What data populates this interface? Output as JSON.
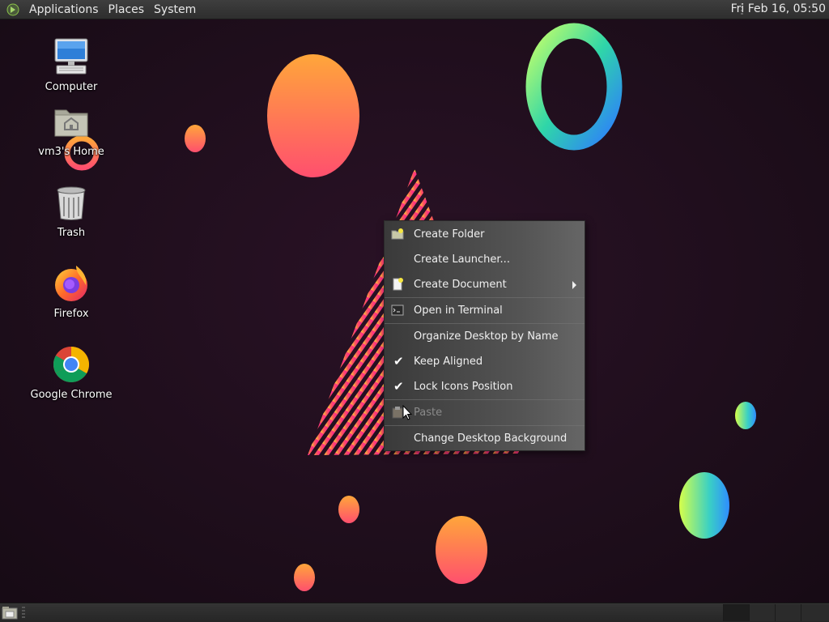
{
  "top_panel": {
    "menus": [
      "Applications",
      "Places",
      "System"
    ],
    "clock": "Fri Feb 16, 05:50"
  },
  "desktop_icons": [
    {
      "label": "Computer",
      "icon": "computer-icon"
    },
    {
      "label": "vm3's Home",
      "icon": "home-folder-icon"
    },
    {
      "label": "Trash",
      "icon": "trash-icon"
    },
    {
      "label": "Firefox",
      "icon": "firefox-icon"
    },
    {
      "label": "Google Chrome",
      "icon": "chrome-icon"
    }
  ],
  "context_menu": {
    "items": [
      {
        "label": "Create Folder",
        "icon": "folder-new-icon"
      },
      {
        "label": "Create Launcher..."
      },
      {
        "label": "Create Document",
        "icon": "document-new-icon",
        "submenu": true
      },
      {
        "label": "Open in Terminal",
        "icon": "terminal-icon"
      },
      {
        "label": "Organize Desktop by Name"
      },
      {
        "label": "Keep Aligned",
        "checked": true
      },
      {
        "label": "Lock Icons Position",
        "checked": true
      },
      {
        "label": "Paste",
        "icon": "paste-icon",
        "disabled": true
      },
      {
        "label": "Change Desktop Background"
      }
    ]
  },
  "bottom_panel": {
    "workspaces": 4,
    "active_workspace": 1
  }
}
